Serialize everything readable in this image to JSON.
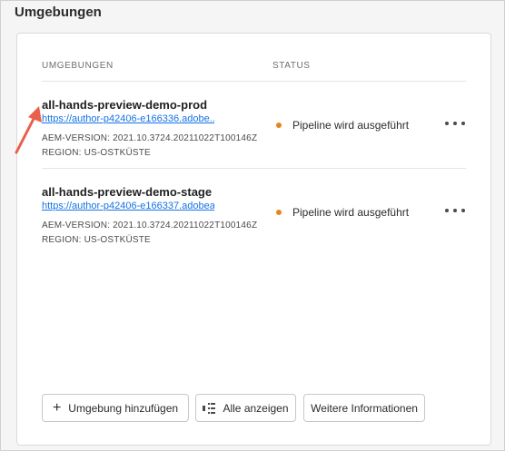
{
  "section": {
    "title": "Umgebungen"
  },
  "table": {
    "headers": {
      "env": "UMGEBUNGEN",
      "status": "STATUS"
    },
    "rows": [
      {
        "name": "all-hands-preview-demo-prod",
        "link": "https://author-p42406-e166336.adobe...",
        "version": "AEM-VERSION: 2021.10.3724.20211022T100146Z",
        "region": "REGION: US-OSTKÜSTE",
        "status": "Pipeline wird ausgeführt"
      },
      {
        "name": "all-hands-preview-demo-stage",
        "link": "https://author-p42406-e166337.adobea...",
        "version": "AEM-VERSION: 2021.10.3724.20211022T100146Z",
        "region": "REGION: US-OSTKÜSTE",
        "status": "Pipeline wird ausgeführt"
      }
    ]
  },
  "footer": {
    "add_label": "Umgebung hinzufügen",
    "all_label": "Alle anzeigen",
    "info_label": "Weitere Informationen"
  },
  "colors": {
    "status_running": "#e68619",
    "link": "#1473e6",
    "annotation_arrow": "#e8604c"
  },
  "icons": {
    "add": "plus-icon",
    "all": "list-view-icon",
    "more": "more-horizontal-icon"
  }
}
